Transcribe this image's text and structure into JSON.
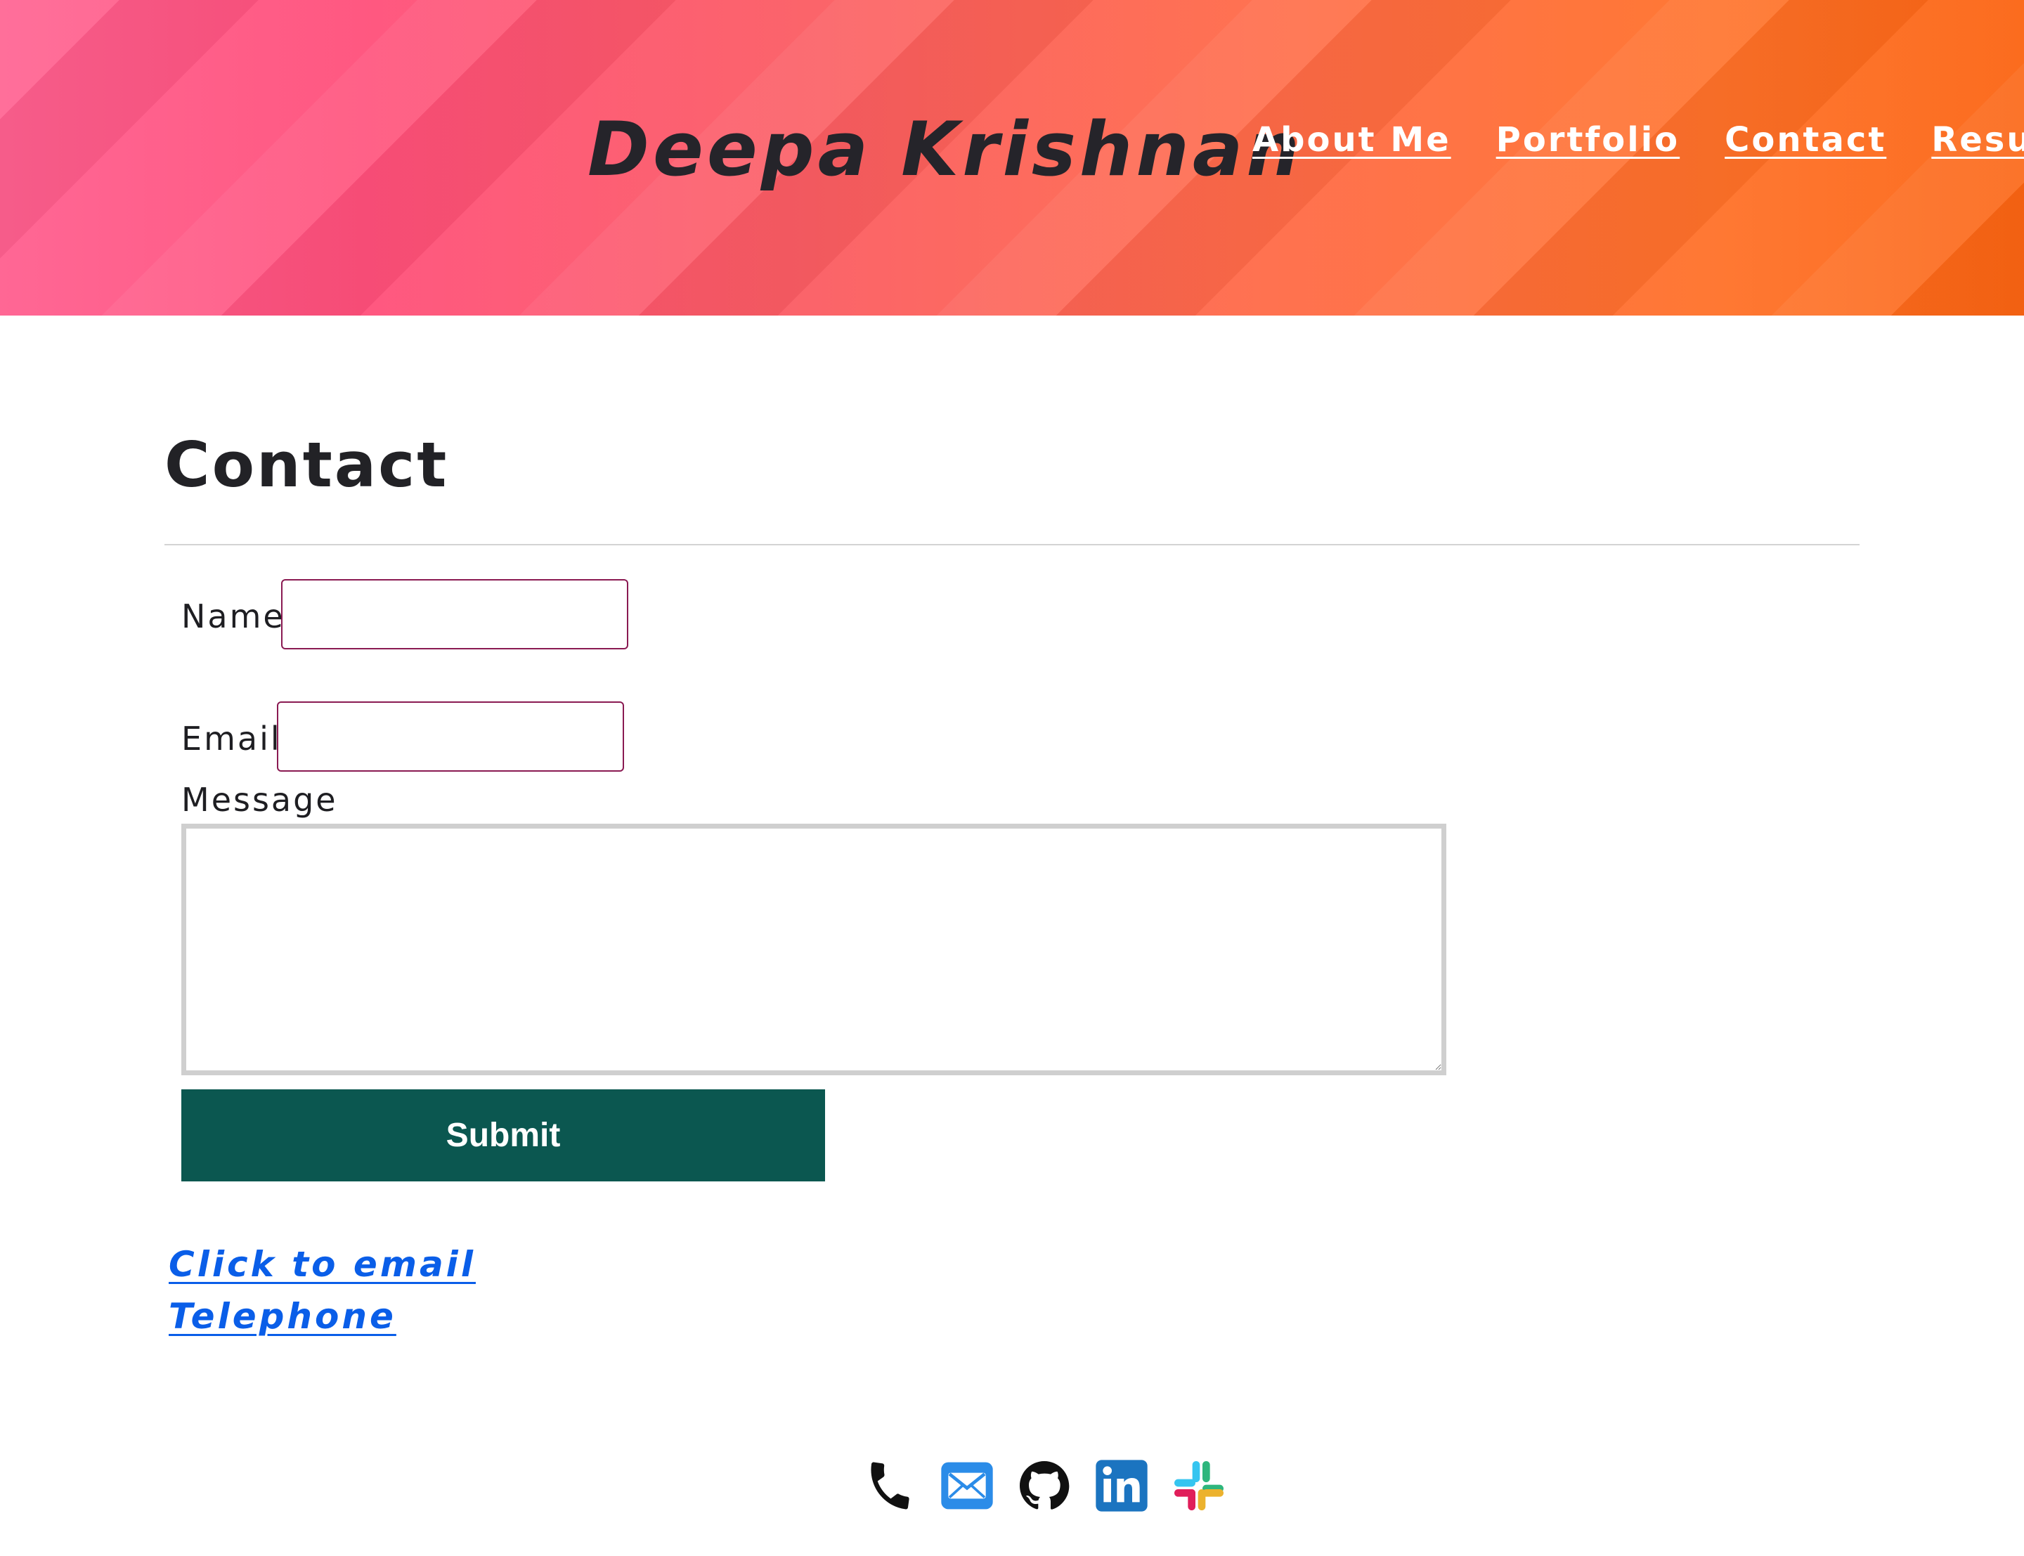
{
  "header": {
    "brand": "Deepa Krishnan",
    "nav": [
      {
        "label": "About Me"
      },
      {
        "label": "Portfolio"
      },
      {
        "label": "Contact"
      },
      {
        "label": "Resume"
      }
    ]
  },
  "main": {
    "title": "Contact",
    "form": {
      "name_label": "Name",
      "name_value": "",
      "email_label": "Email",
      "email_value": "",
      "message_label": "Message",
      "message_value": "",
      "submit_label": "Submit"
    },
    "links": {
      "email": "Click to email",
      "telephone": "Telephone"
    }
  },
  "footer": {
    "social_icons": [
      "phone-icon",
      "mail-icon",
      "github-icon",
      "linkedin-icon",
      "slack-icon"
    ]
  },
  "colors": {
    "header_gradient_start": "#ff5f8f",
    "header_gradient_end": "#fb6412",
    "nav_text": "#ffffff",
    "brand_text": "#25242a",
    "link": "#0a5ee8",
    "submit_bg": "#0b5750",
    "input_border": "#8a1a52"
  }
}
